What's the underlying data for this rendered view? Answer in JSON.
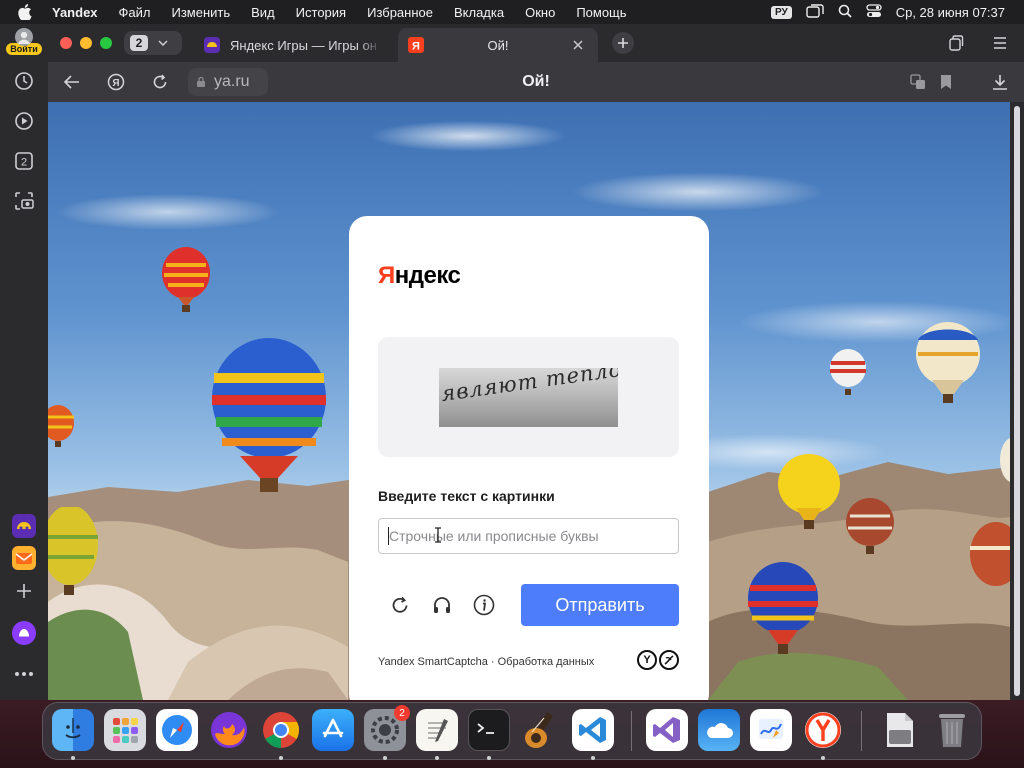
{
  "menubar": {
    "app_name": "Yandex",
    "items": [
      "Файл",
      "Изменить",
      "Вид",
      "История",
      "Избранное",
      "Вкладка",
      "Окно",
      "Помощь"
    ],
    "input_language": "РУ",
    "datetime": "Ср, 28 июня  07:37"
  },
  "browser": {
    "login_label": "Войти",
    "tab_count": "2",
    "sidebar_counter": "2",
    "tabs": [
      {
        "title": "Яндекс Игры — Игры он",
        "active": false
      },
      {
        "title": "Ой!",
        "active": true
      }
    ],
    "address": "ya.ru",
    "page_title": "Ой!"
  },
  "captcha": {
    "logo_first_letter": "Я",
    "logo_rest": "ндекс",
    "captcha_text": "являют тепло",
    "prompt": "Введите текст с картинки",
    "input_placeholder": "Строчные или прописные буквы",
    "input_value": "",
    "submit_label": "Отправить",
    "footer": "Yandex SmartCaptcha · Обработка данных"
  },
  "dock": {
    "apps": [
      "Finder",
      "Launchpad",
      "Safari",
      "Firefox",
      "Chrome",
      "App Store",
      "System Settings",
      "TextEdit",
      "Terminal",
      "GarageBand",
      "Visual Studio Code",
      "Visual Studio",
      "Weather",
      "Freeform",
      "Yandex Browser",
      "Downloads",
      "Trash"
    ],
    "settings_badge": "2"
  },
  "colors": {
    "submit": "#4e7dfc",
    "logo_red": "#fc3f1d",
    "login_yellow": "#f7c71b"
  }
}
